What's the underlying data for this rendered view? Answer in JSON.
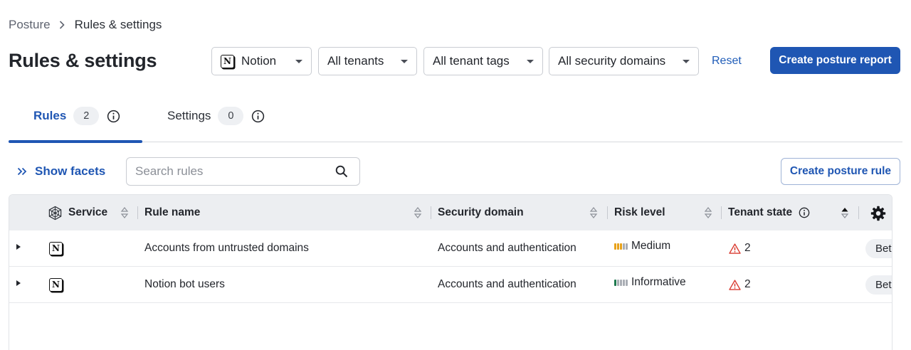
{
  "breadcrumb": {
    "root": "Posture",
    "current": "Rules & settings"
  },
  "page_title": "Rules & settings",
  "filters": {
    "service": "Notion",
    "tenants": "All tenants",
    "tags": "All tenant tags",
    "domains": "All security domains"
  },
  "reset_label": "Reset",
  "create_report_label": "Create posture report",
  "tabs": [
    {
      "label": "Rules",
      "count": "2"
    },
    {
      "label": "Settings",
      "count": "0"
    }
  ],
  "show_facets_label": "Show facets",
  "search": {
    "placeholder": "Search rules",
    "value": ""
  },
  "create_rule_label": "Create posture rule",
  "table": {
    "columns": {
      "service": "Service",
      "rule_name": "Rule name",
      "security_domain": "Security domain",
      "risk_level": "Risk level",
      "tenant_state": "Tenant state"
    },
    "rows": [
      {
        "service_icon": "notion-logo-icon",
        "rule_name": "Accounts from untrusted domains",
        "security_domain": "Accounts and authentication",
        "risk_level": "Medium",
        "risk_bars_filled": 3,
        "risk_color": "#e8a21a",
        "tenant_state_count": "2",
        "badge": "Bet"
      },
      {
        "service_icon": "notion-logo-icon",
        "rule_name": "Notion bot users",
        "security_domain": "Accounts and authentication",
        "risk_level": "Informative",
        "risk_bars_filled": 1,
        "risk_color": "#1e7a4e",
        "tenant_state_count": "2",
        "badge": "Bet"
      }
    ]
  },
  "colors": {
    "accent": "#1f56b3",
    "warning": "#d93b30",
    "risk_empty": "#a9adb4"
  }
}
